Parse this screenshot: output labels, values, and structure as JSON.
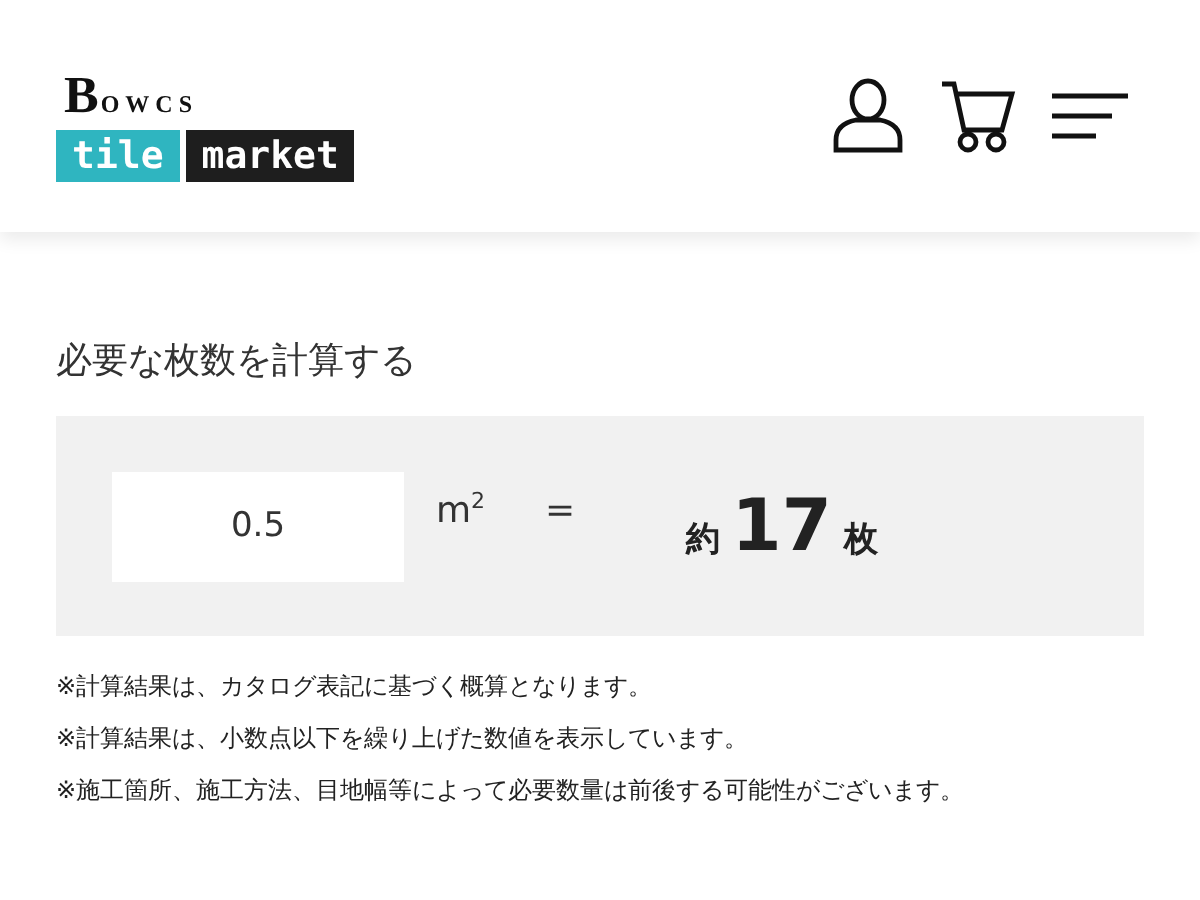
{
  "header": {
    "logo": {
      "brand": "BOWCS",
      "word_1": "tile",
      "word_2": "market"
    }
  },
  "calculator": {
    "title": "必要な枚数を計算する",
    "input": {
      "value": "0.5"
    },
    "unit": "m$^{2}$",
    "equals": "=",
    "result": {
      "prefix": "約",
      "value": "17",
      "suffix": "枚"
    }
  },
  "notes": [
    "※計算結果は、カタログ表記に基づく概算となります。",
    "※計算結果は、小数点以下を繰り上げた数値を表示しています。",
    "※施工箇所、施工方法、目地幅等によって必要数量は前後する可能性がございます。"
  ]
}
